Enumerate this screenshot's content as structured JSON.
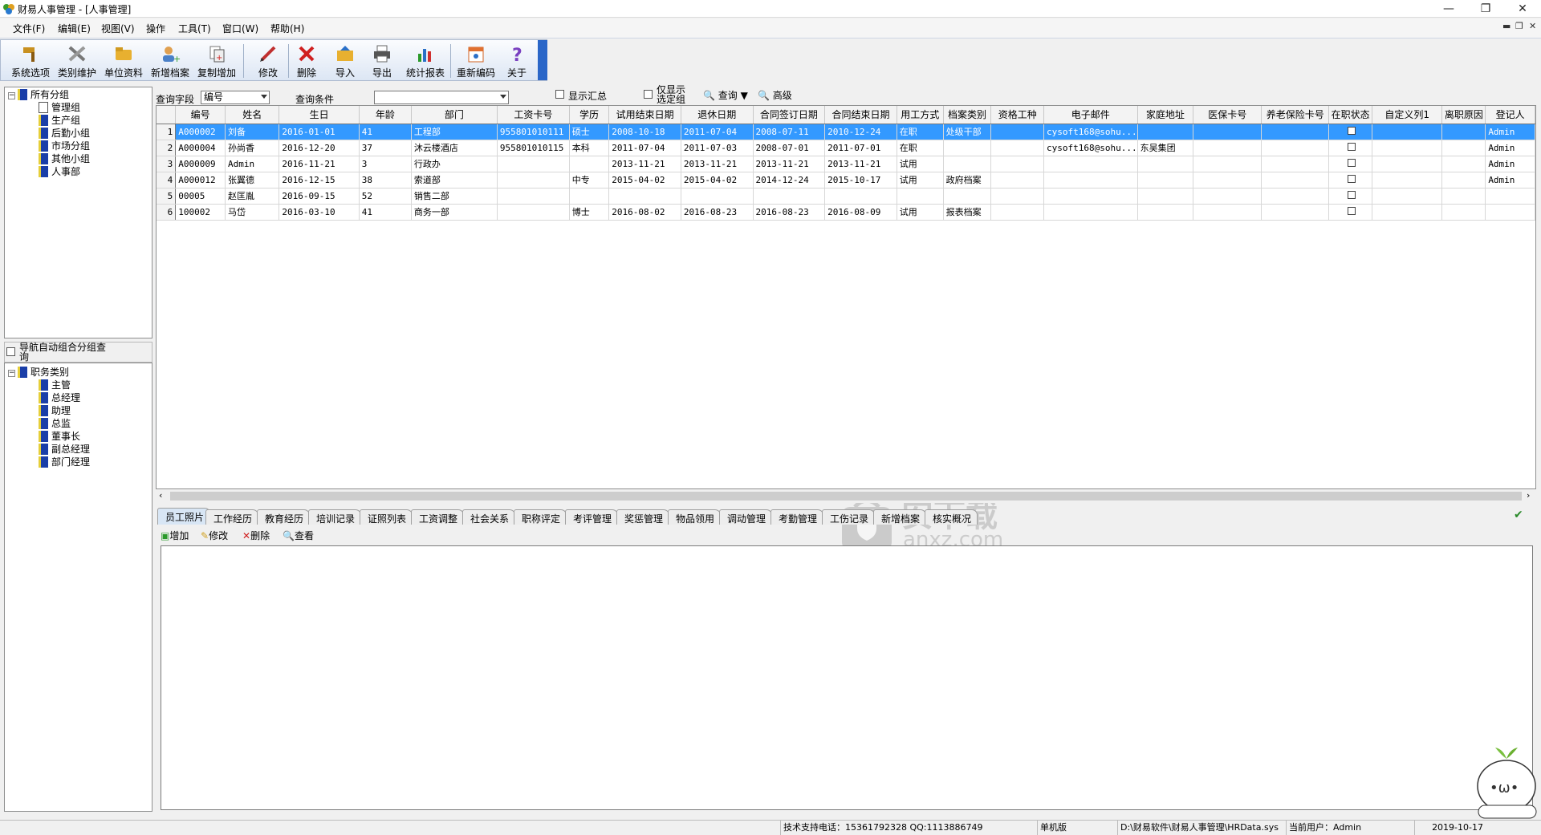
{
  "window": {
    "title": "财易人事管理 - [人事管理]"
  },
  "menu": [
    "文件(F)",
    "编辑(E)",
    "视图(V)",
    "操作",
    "工具(T)",
    "窗口(W)",
    "帮助(H)"
  ],
  "toolbar": [
    "系统选项",
    "类别维护",
    "单位资料",
    "新增档案",
    "复制增加",
    "修改",
    "删除",
    "导入",
    "导出",
    "统计报表",
    "重新编码",
    "关于"
  ],
  "tree_groups": {
    "root": "所有分组",
    "items": [
      "管理组",
      "生产组",
      "后勤小组",
      "市场分组",
      "其他小组",
      "人事部"
    ]
  },
  "nav_option": {
    "label": "导航自动组合分组查询"
  },
  "tree_positions": {
    "root": "职务类别",
    "items": [
      "主管",
      "总经理",
      "助理",
      "总监",
      "董事长",
      "副总经理",
      "部门经理"
    ]
  },
  "query": {
    "field_label": "查询字段",
    "field_value": "编号",
    "cond_label": "查询条件",
    "cond_value": "",
    "show_summary": "显示汇总",
    "only_selected": "仅显示选定组",
    "search": "查询",
    "advanced": "高级"
  },
  "grid": {
    "columns": [
      "编号",
      "姓名",
      "生日",
      "年龄",
      "部门",
      "工资卡号",
      "学历",
      "试用结束日期",
      "退休日期",
      "合同签订日期",
      "合同结束日期",
      "用工方式",
      "档案类别",
      "资格工种",
      "电子邮件",
      "家庭地址",
      "医保卡号",
      "养老保险卡号",
      "在职状态",
      "自定义列1",
      "离职原因",
      "登记人"
    ],
    "rows": [
      [
        "1",
        "A000002",
        "刘备",
        "2016-01-01",
        "41",
        "工程部",
        "955801010111",
        "硕士",
        "2008-10-18",
        "2011-07-04",
        "2008-07-11",
        "2010-12-24",
        "在职",
        "处级干部",
        "",
        "cysoft168@sohu...",
        "",
        "",
        "",
        "",
        "",
        "",
        "Admin"
      ],
      [
        "2",
        "A000004",
        "孙尚香",
        "2016-12-20",
        "37",
        "沐云楼酒店",
        "955801010115",
        "本科",
        "2011-07-04",
        "2011-07-03",
        "2008-07-01",
        "2011-07-01",
        "在职",
        "",
        "",
        "cysoft168@sohu...",
        "东吴集团",
        "",
        "",
        "",
        "",
        "",
        "Admin"
      ],
      [
        "3",
        "A000009",
        "Admin",
        "2016-11-21",
        "3",
        "行政办",
        "",
        "",
        "2013-11-21",
        "2013-11-21",
        "2013-11-21",
        "2013-11-21",
        "试用",
        "",
        "",
        "",
        "",
        "",
        "",
        "",
        "",
        "",
        "Admin"
      ],
      [
        "4",
        "A000012",
        "张翼德",
        "2016-12-15",
        "38",
        "索道部",
        "",
        "中专",
        "2015-04-02",
        "2015-04-02",
        "2014-12-24",
        "2015-10-17",
        "试用",
        "政府档案",
        "",
        "",
        "",
        "",
        "",
        "",
        "",
        "",
        "Admin"
      ],
      [
        "5",
        "00005",
        "赵匡胤",
        "2016-09-15",
        "52",
        "销售二部",
        "",
        "",
        "",
        "",
        "",
        "",
        "",
        "",
        "",
        "",
        "",
        "",
        "",
        "",
        "",
        "",
        ""
      ],
      [
        "6",
        "100002",
        "马岱",
        "2016-03-10",
        "41",
        "商务一部",
        "",
        "博士",
        "2016-08-02",
        "2016-08-23",
        "2016-08-23",
        "2016-08-09",
        "试用",
        "报表档案",
        "",
        "",
        "",
        "",
        "",
        "",
        "",
        "",
        ""
      ]
    ]
  },
  "tabs": [
    "员工照片",
    "工作经历",
    "教育经历",
    "培训记录",
    "证照列表",
    "工资调整",
    "社会关系",
    "职称评定",
    "考评管理",
    "奖惩管理",
    "物品领用",
    "调动管理",
    "考勤管理",
    "工伤记录",
    "新增档案",
    "核实概况"
  ],
  "subtoolbar": [
    "增加",
    "修改",
    "删除",
    "查看"
  ],
  "watermark": {
    "text": "安下载",
    "sub": "anxz.com"
  },
  "status": {
    "support": "技术支持电话：15361792328 QQ:1113886749",
    "edition": "单机版",
    "path": "D:\\财易软件\\财易人事管理\\HRData.sys",
    "user": "当前用户：Admin",
    "date": "2019-10-17"
  },
  "colors": {
    "selection": "#3399ff",
    "toolbar_accent": "#2a66c8"
  }
}
